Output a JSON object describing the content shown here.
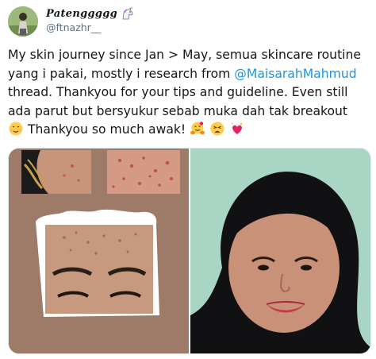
{
  "author": {
    "display_name": "Patenggggg",
    "name_emoji": "unicorn-icon",
    "handle": "@ftnazhr__"
  },
  "tweet": {
    "line1": "My skin journey since Jan > May, semua skincare routine",
    "line2_before": "yang i pakai, mostly i research from ",
    "mention": "@MaisarahMahmud",
    "line3": "thread. Thankyou for your tips and guideline. Even still",
    "line4": "ada parut but bersyukur sebab muka dah tak breakout",
    "line5": "Thankyou so much awak!",
    "emojis": [
      "smiling-face-icon",
      "hugging-face-icon",
      "weary-face-icon",
      "sparkling-heart-icon"
    ]
  },
  "media": {
    "photos": [
      "before-collage-photo",
      "after-selfie-photo"
    ]
  },
  "colors": {
    "mention": "#1b95e0",
    "handle": "#5b7083",
    "border": "#e1e8ed"
  }
}
